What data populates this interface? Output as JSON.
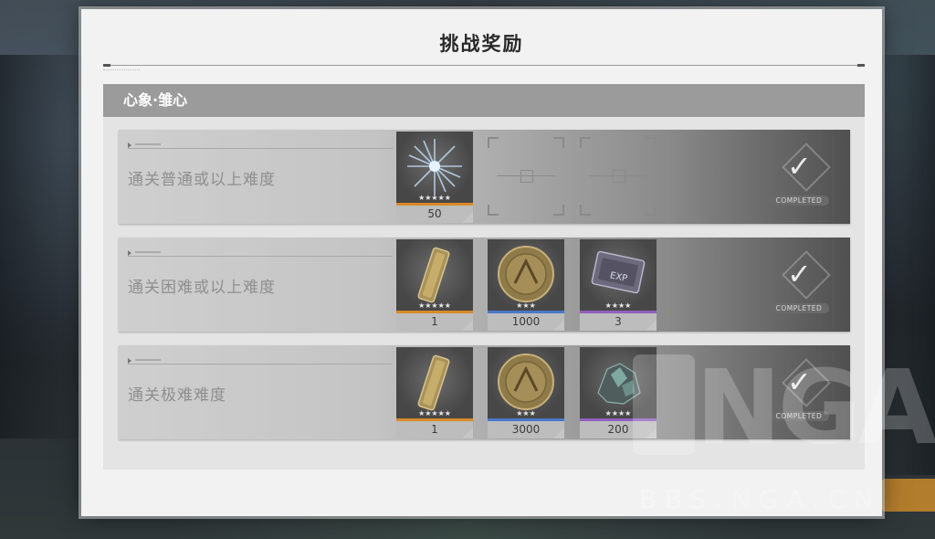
{
  "dialog": {
    "title": "挑战奖励",
    "section_title": "心象·雏心"
  },
  "rows": [
    {
      "label": "通关普通或以上难度",
      "status": "COMPLETED",
      "rewards": [
        {
          "icon": "crystal-shard-icon",
          "count": "50",
          "stars": "★★★★★",
          "rarity_color": "#d88a28"
        }
      ],
      "empty_slots": 2
    },
    {
      "label": "通关困难或以上难度",
      "status": "COMPLETED",
      "rewards": [
        {
          "icon": "golden-scroll-icon",
          "count": "1",
          "stars": "★★★★★",
          "rarity_color": "#d88a28"
        },
        {
          "icon": "gold-coin-icon",
          "count": "1000",
          "stars": "★★★",
          "rarity_color": "#4a78c8"
        },
        {
          "icon": "exp-card-icon",
          "count": "3",
          "stars": "★★★★",
          "rarity_color": "#9060c0"
        }
      ]
    },
    {
      "label": "通关极难难度",
      "status": "COMPLETED",
      "rewards": [
        {
          "icon": "golden-scroll-icon",
          "count": "1",
          "stars": "★★★★★",
          "rarity_color": "#d88a28"
        },
        {
          "icon": "gold-coin-icon",
          "count": "3000",
          "stars": "★★★",
          "rarity_color": "#4a78c8"
        },
        {
          "icon": "crystal-ore-icon",
          "count": "200",
          "stars": "★★★★",
          "rarity_color": "#9060c0"
        }
      ]
    }
  ],
  "watermark": {
    "logo": "NGA",
    "url": "BBS.NGA.CN"
  }
}
